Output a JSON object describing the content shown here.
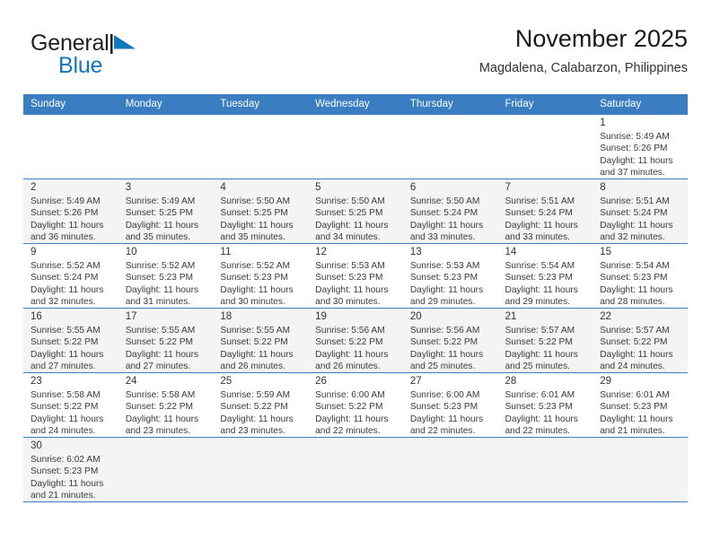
{
  "brand": {
    "name_top": "General",
    "name_bottom": "Blue",
    "icon": "blue-flag-triangle",
    "color_top": "#231f20",
    "color_bottom": "#1278be"
  },
  "header": {
    "title": "November 2025",
    "subtitle": "Magdalena, Calabarzon, Philippines"
  },
  "colors": {
    "header_blue": "#3a7dc0",
    "row_shade": "#f4f4f4",
    "text": "#3b3b3b"
  },
  "weekdays": [
    "Sunday",
    "Monday",
    "Tuesday",
    "Wednesday",
    "Thursday",
    "Friday",
    "Saturday"
  ],
  "labels": {
    "sunrise": "Sunrise:",
    "sunset": "Sunset:",
    "daylight": "Daylight:"
  },
  "weeks": [
    {
      "shaded": false,
      "days": [
        {
          "empty": true
        },
        {
          "empty": true
        },
        {
          "empty": true
        },
        {
          "empty": true
        },
        {
          "empty": true
        },
        {
          "empty": true
        },
        {
          "day": "1",
          "sunrise": "Sunrise: 5:49 AM",
          "sunset": "Sunset: 5:26 PM",
          "daylight_line1": "Daylight: 11 hours",
          "daylight_line2": "and 37 minutes."
        }
      ]
    },
    {
      "shaded": true,
      "days": [
        {
          "day": "2",
          "sunrise": "Sunrise: 5:49 AM",
          "sunset": "Sunset: 5:26 PM",
          "daylight_line1": "Daylight: 11 hours",
          "daylight_line2": "and 36 minutes."
        },
        {
          "day": "3",
          "sunrise": "Sunrise: 5:49 AM",
          "sunset": "Sunset: 5:25 PM",
          "daylight_line1": "Daylight: 11 hours",
          "daylight_line2": "and 35 minutes."
        },
        {
          "day": "4",
          "sunrise": "Sunrise: 5:50 AM",
          "sunset": "Sunset: 5:25 PM",
          "daylight_line1": "Daylight: 11 hours",
          "daylight_line2": "and 35 minutes."
        },
        {
          "day": "5",
          "sunrise": "Sunrise: 5:50 AM",
          "sunset": "Sunset: 5:25 PM",
          "daylight_line1": "Daylight: 11 hours",
          "daylight_line2": "and 34 minutes."
        },
        {
          "day": "6",
          "sunrise": "Sunrise: 5:50 AM",
          "sunset": "Sunset: 5:24 PM",
          "daylight_line1": "Daylight: 11 hours",
          "daylight_line2": "and 33 minutes."
        },
        {
          "day": "7",
          "sunrise": "Sunrise: 5:51 AM",
          "sunset": "Sunset: 5:24 PM",
          "daylight_line1": "Daylight: 11 hours",
          "daylight_line2": "and 33 minutes."
        },
        {
          "day": "8",
          "sunrise": "Sunrise: 5:51 AM",
          "sunset": "Sunset: 5:24 PM",
          "daylight_line1": "Daylight: 11 hours",
          "daylight_line2": "and 32 minutes."
        }
      ]
    },
    {
      "shaded": false,
      "days": [
        {
          "day": "9",
          "sunrise": "Sunrise: 5:52 AM",
          "sunset": "Sunset: 5:24 PM",
          "daylight_line1": "Daylight: 11 hours",
          "daylight_line2": "and 32 minutes."
        },
        {
          "day": "10",
          "sunrise": "Sunrise: 5:52 AM",
          "sunset": "Sunset: 5:23 PM",
          "daylight_line1": "Daylight: 11 hours",
          "daylight_line2": "and 31 minutes."
        },
        {
          "day": "11",
          "sunrise": "Sunrise: 5:52 AM",
          "sunset": "Sunset: 5:23 PM",
          "daylight_line1": "Daylight: 11 hours",
          "daylight_line2": "and 30 minutes."
        },
        {
          "day": "12",
          "sunrise": "Sunrise: 5:53 AM",
          "sunset": "Sunset: 5:23 PM",
          "daylight_line1": "Daylight: 11 hours",
          "daylight_line2": "and 30 minutes."
        },
        {
          "day": "13",
          "sunrise": "Sunrise: 5:53 AM",
          "sunset": "Sunset: 5:23 PM",
          "daylight_line1": "Daylight: 11 hours",
          "daylight_line2": "and 29 minutes."
        },
        {
          "day": "14",
          "sunrise": "Sunrise: 5:54 AM",
          "sunset": "Sunset: 5:23 PM",
          "daylight_line1": "Daylight: 11 hours",
          "daylight_line2": "and 29 minutes."
        },
        {
          "day": "15",
          "sunrise": "Sunrise: 5:54 AM",
          "sunset": "Sunset: 5:23 PM",
          "daylight_line1": "Daylight: 11 hours",
          "daylight_line2": "and 28 minutes."
        }
      ]
    },
    {
      "shaded": true,
      "days": [
        {
          "day": "16",
          "sunrise": "Sunrise: 5:55 AM",
          "sunset": "Sunset: 5:22 PM",
          "daylight_line1": "Daylight: 11 hours",
          "daylight_line2": "and 27 minutes."
        },
        {
          "day": "17",
          "sunrise": "Sunrise: 5:55 AM",
          "sunset": "Sunset: 5:22 PM",
          "daylight_line1": "Daylight: 11 hours",
          "daylight_line2": "and 27 minutes."
        },
        {
          "day": "18",
          "sunrise": "Sunrise: 5:55 AM",
          "sunset": "Sunset: 5:22 PM",
          "daylight_line1": "Daylight: 11 hours",
          "daylight_line2": "and 26 minutes."
        },
        {
          "day": "19",
          "sunrise": "Sunrise: 5:56 AM",
          "sunset": "Sunset: 5:22 PM",
          "daylight_line1": "Daylight: 11 hours",
          "daylight_line2": "and 26 minutes."
        },
        {
          "day": "20",
          "sunrise": "Sunrise: 5:56 AM",
          "sunset": "Sunset: 5:22 PM",
          "daylight_line1": "Daylight: 11 hours",
          "daylight_line2": "and 25 minutes."
        },
        {
          "day": "21",
          "sunrise": "Sunrise: 5:57 AM",
          "sunset": "Sunset: 5:22 PM",
          "daylight_line1": "Daylight: 11 hours",
          "daylight_line2": "and 25 minutes."
        },
        {
          "day": "22",
          "sunrise": "Sunrise: 5:57 AM",
          "sunset": "Sunset: 5:22 PM",
          "daylight_line1": "Daylight: 11 hours",
          "daylight_line2": "and 24 minutes."
        }
      ]
    },
    {
      "shaded": false,
      "days": [
        {
          "day": "23",
          "sunrise": "Sunrise: 5:58 AM",
          "sunset": "Sunset: 5:22 PM",
          "daylight_line1": "Daylight: 11 hours",
          "daylight_line2": "and 24 minutes."
        },
        {
          "day": "24",
          "sunrise": "Sunrise: 5:58 AM",
          "sunset": "Sunset: 5:22 PM",
          "daylight_line1": "Daylight: 11 hours",
          "daylight_line2": "and 23 minutes."
        },
        {
          "day": "25",
          "sunrise": "Sunrise: 5:59 AM",
          "sunset": "Sunset: 5:22 PM",
          "daylight_line1": "Daylight: 11 hours",
          "daylight_line2": "and 23 minutes."
        },
        {
          "day": "26",
          "sunrise": "Sunrise: 6:00 AM",
          "sunset": "Sunset: 5:22 PM",
          "daylight_line1": "Daylight: 11 hours",
          "daylight_line2": "and 22 minutes."
        },
        {
          "day": "27",
          "sunrise": "Sunrise: 6:00 AM",
          "sunset": "Sunset: 5:23 PM",
          "daylight_line1": "Daylight: 11 hours",
          "daylight_line2": "and 22 minutes."
        },
        {
          "day": "28",
          "sunrise": "Sunrise: 6:01 AM",
          "sunset": "Sunset: 5:23 PM",
          "daylight_line1": "Daylight: 11 hours",
          "daylight_line2": "and 22 minutes."
        },
        {
          "day": "29",
          "sunrise": "Sunrise: 6:01 AM",
          "sunset": "Sunset: 5:23 PM",
          "daylight_line1": "Daylight: 11 hours",
          "daylight_line2": "and 21 minutes."
        }
      ]
    },
    {
      "shaded": true,
      "days": [
        {
          "day": "30",
          "sunrise": "Sunrise: 6:02 AM",
          "sunset": "Sunset: 5:23 PM",
          "daylight_line1": "Daylight: 11 hours",
          "daylight_line2": "and 21 minutes."
        },
        {
          "empty": true
        },
        {
          "empty": true
        },
        {
          "empty": true
        },
        {
          "empty": true
        },
        {
          "empty": true
        },
        {
          "empty": true
        }
      ]
    }
  ]
}
